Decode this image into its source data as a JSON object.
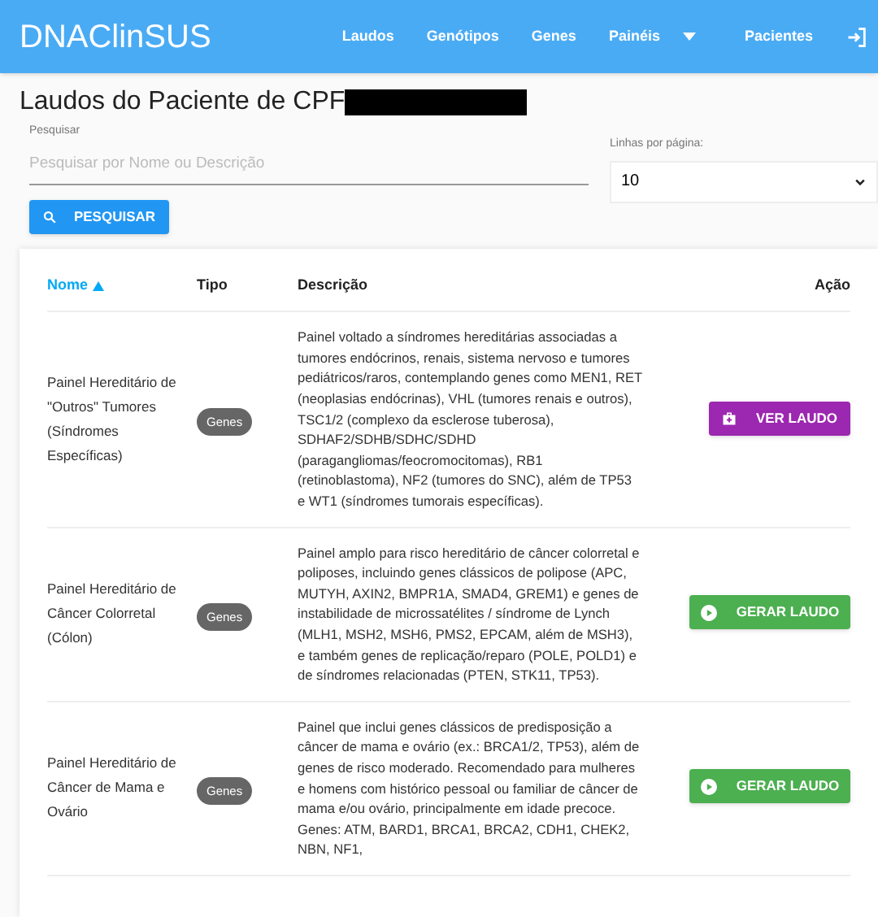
{
  "navbar": {
    "brand": "DNAClinSUS",
    "items": [
      {
        "label": "Laudos",
        "dropdown": false
      },
      {
        "label": "Genótipos",
        "dropdown": false
      },
      {
        "label": "Genes",
        "dropdown": false
      },
      {
        "label": "Painéis",
        "dropdown": true
      },
      {
        "label": "Pacientes",
        "dropdown": false
      }
    ]
  },
  "page_title": "Laudos do Paciente de CPF",
  "search": {
    "label": "Pesquisar",
    "placeholder": "Pesquisar por Nome ou Descrição",
    "button": "PESQUISAR"
  },
  "rows_per_page": {
    "label": "Linhas por página:",
    "value": "10"
  },
  "table": {
    "columns": [
      {
        "label": "Nome",
        "sorted": true
      },
      {
        "label": "Tipo",
        "sorted": false
      },
      {
        "label": "Descrição",
        "sorted": false
      },
      {
        "label": "Ação",
        "sorted": false
      }
    ],
    "rows": [
      {
        "name": "Painel Hereditário de \"Outros\" Tumores (Síndromes Específicas)",
        "type": "Genes",
        "description": "Painel voltado a síndromes hereditárias associadas a tumores endócrinos, renais, sistema nervoso e tumores pediátricos/raros, contemplando genes como MEN1, RET (neoplasias endócrinas), VHL (tumores renais e outros), TSC1/2 (complexo da esclerose tuberosa), SDHAF2/SDHB/SDHC/SDHD (paragangliomas/feocromocitomas), RB1 (retinoblastoma), NF2 (tumores do SNC), além de TP53 e WT1 (síndromes tumorais específicas).",
        "action": {
          "kind": "view",
          "label": "VER LAUDO"
        }
      },
      {
        "name": "Painel Hereditário de Câncer Colorretal (Cólon)",
        "type": "Genes",
        "description": "Painel amplo para risco hereditário de câncer colorretal e poliposes, incluindo genes clássicos de polipose (APC, MUTYH, AXIN2, BMPR1A, SMAD4, GREM1) e genes de instabilidade de microssatélites / síndrome de Lynch (MLH1, MSH2, MSH6, PMS2, EPCAM, além de MSH3), e também genes de replicação/reparo (POLE, POLD1) e de síndromes relacionadas (PTEN, STK11, TP53).",
        "action": {
          "kind": "generate",
          "label": "GERAR LAUDO"
        }
      },
      {
        "name": "Painel Hereditário de Câncer de Mama e Ovário",
        "type": "Genes",
        "description": "Painel que inclui genes clássicos de predisposição a câncer de mama e ovário (ex.: BRCA1/2, TP53), além de genes de risco moderado. Recomendado para mulheres e homens com histórico pessoal ou familiar de câncer de mama e/ou ovário, principalmente em idade precoce. Genes: ATM, BARD1, BRCA1, BRCA2, CDH1, CHEK2, NBN, NF1,",
        "action": {
          "kind": "generate",
          "label": "GERAR LAUDO"
        }
      }
    ]
  }
}
